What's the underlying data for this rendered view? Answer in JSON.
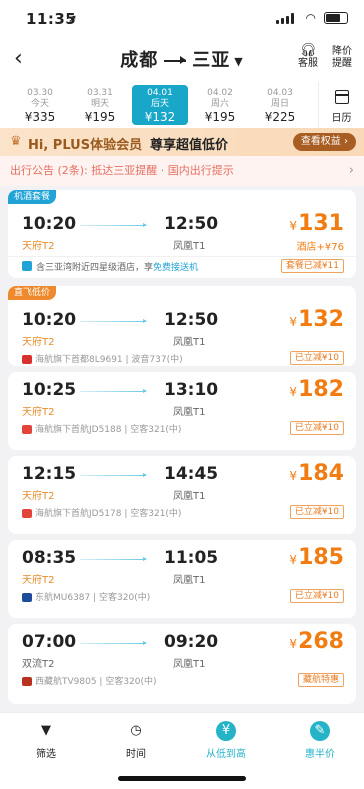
{
  "status": {
    "time": "11:35",
    "location_icon": "location-arrow-icon"
  },
  "header": {
    "from": "成都",
    "to": "三亚",
    "service_label": "客服",
    "price_alert_label": "降价提醒"
  },
  "dates": [
    {
      "date": "03.30",
      "weekday": "今天",
      "price": "¥335",
      "selected": false
    },
    {
      "date": "03.31",
      "weekday": "明天",
      "price": "¥195",
      "selected": false
    },
    {
      "date": "04.01",
      "weekday": "后天",
      "price": "¥132",
      "selected": true
    },
    {
      "date": "04.02",
      "weekday": "周六",
      "price": "¥195",
      "selected": false
    },
    {
      "date": "04.03",
      "weekday": "周日",
      "price": "¥225",
      "selected": false
    }
  ],
  "calendar_label": "日历",
  "plus": {
    "title": "Hi, PLUS体验会员",
    "subtitle": "尊享超值低价",
    "button": "查看权益 ›"
  },
  "notice": {
    "text": "出行公告 (2条): 抵达三亚提醒 · 国内出行提示"
  },
  "flights": [
    {
      "tag": "机酒套餐",
      "tag_color": "#21a3d6",
      "dep_time": "10:20",
      "dep_airport": "天府T2",
      "dep_color": "orange",
      "arr_time": "12:50",
      "arr_airport": "凤凰T1",
      "price": "131",
      "sub": "酒店+¥76",
      "discount": "套餐已减¥11",
      "hotel": "含三亚湾附近四星级酒店，享",
      "hotel_hl": "免费接送机"
    },
    {
      "tag": "直飞低价",
      "tag_color": "#ee8a2d",
      "dep_time": "10:20",
      "dep_airport": "天府T2",
      "dep_color": "orange",
      "arr_time": "12:50",
      "arr_airport": "凤凰T1",
      "price": "132",
      "airline": "海航旗下首都8L9691 | 波音737(中)",
      "airline_color": "#d9312b",
      "discount": "已立减¥10"
    },
    {
      "dep_time": "10:25",
      "dep_airport": "天府T2",
      "dep_color": "orange",
      "arr_time": "13:10",
      "arr_airport": "凤凰T1",
      "price": "182",
      "airline": "海航旗下首航JD5188 | 空客321(中)",
      "airline_color": "#e2433a",
      "discount": "已立减¥10"
    },
    {
      "dep_time": "12:15",
      "dep_airport": "天府T2",
      "dep_color": "orange",
      "arr_time": "14:45",
      "arr_airport": "凤凰T1",
      "price": "184",
      "airline": "海航旗下首航JD5178 | 空客321(中)",
      "airline_color": "#e2433a",
      "discount": "已立减¥10"
    },
    {
      "dep_time": "08:35",
      "dep_airport": "天府T2",
      "dep_color": "orange",
      "arr_time": "11:05",
      "arr_airport": "凤凰T1",
      "price": "185",
      "airline": "东航MU6387 | 空客320(中)",
      "airline_color": "#1c4c9a",
      "discount": "已立减¥10"
    },
    {
      "dep_time": "07:00",
      "dep_airport": "双流T2",
      "dep_color": "gray",
      "arr_time": "09:20",
      "arr_airport": "凤凰T1",
      "price": "268",
      "airline": "西藏航TV9805 | 空客320(中)",
      "airline_color": "#b8331f",
      "discount": "藏航特惠"
    }
  ],
  "tabbar": [
    {
      "label": "筛选",
      "icon": "filter-icon",
      "selected": false
    },
    {
      "label": "时间",
      "icon": "clock-icon",
      "selected": false
    },
    {
      "label": "从低到高",
      "icon": "yen-icon",
      "selected": true
    },
    {
      "label": "惠半价",
      "icon": "coupon-icon",
      "selected": false
    }
  ]
}
